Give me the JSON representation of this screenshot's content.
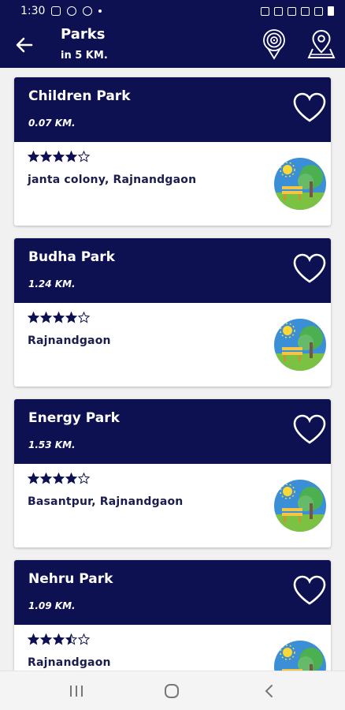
{
  "status_bar": {
    "time": "1:30"
  },
  "header": {
    "title": "Parks",
    "subtitle": "in 5 KM."
  },
  "parks": [
    {
      "name": "Children Park",
      "distance": "0.07 KM.",
      "rating": 4,
      "address": "janta colony, Rajnandgaon"
    },
    {
      "name": "Budha Park",
      "distance": "1.24 KM.",
      "rating": 4,
      "address": "Rajnandgaon"
    },
    {
      "name": "Energy Park",
      "distance": "1.53 KM.",
      "rating": 4,
      "address": "Basantpur, Rajnandgaon"
    },
    {
      "name": "Nehru Park",
      "distance": "1.09 KM.",
      "rating": 3.5,
      "address": "Rajnandgaon"
    }
  ],
  "colors": {
    "primary": "#0d1152",
    "background": "#f1f1f1",
    "star": "#0d1152"
  }
}
